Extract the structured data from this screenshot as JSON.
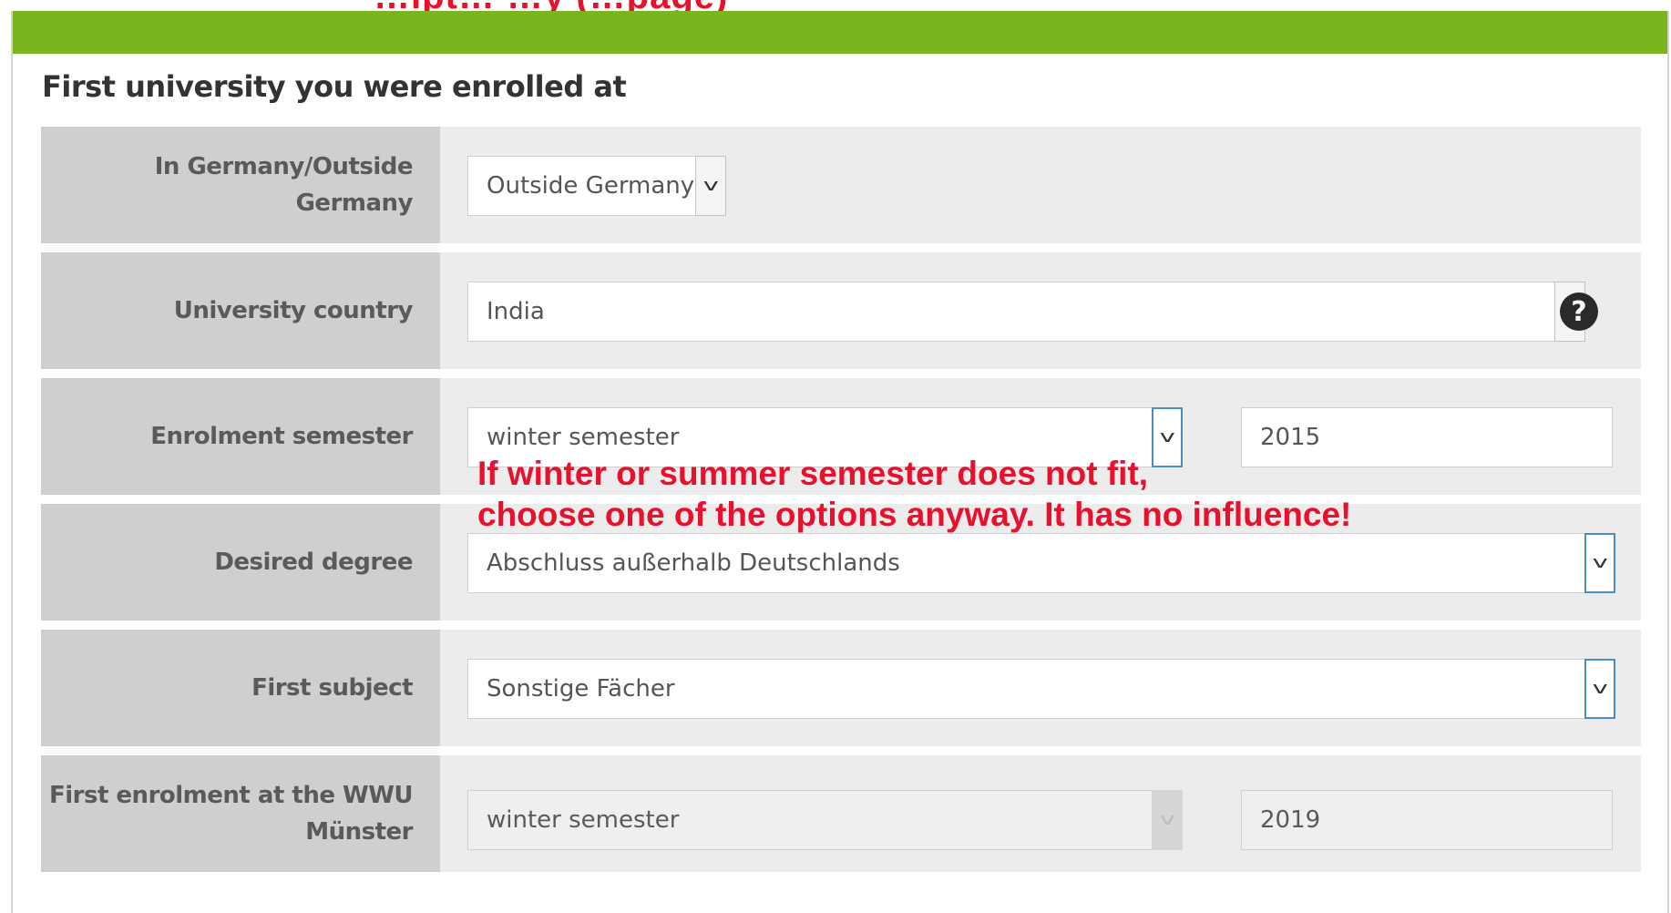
{
  "top_banner_text": "…ipt… …y (…page)",
  "section": {
    "title": "First university you were enrolled at"
  },
  "rows": [
    {
      "label": "In Germany/Outside Germany",
      "select_value": "Outside Germany"
    },
    {
      "label": "University country",
      "select_value": "India",
      "help_icon": "question-circle-icon"
    },
    {
      "label": "Enrolment semester",
      "select_value": "winter semester",
      "year_value": "2015"
    },
    {
      "label": "Desired degree",
      "select_value": "Abschluss außerhalb Deutschlands"
    },
    {
      "label": "First subject",
      "select_value": "Sonstige Fächer"
    },
    {
      "label_line1": "First enrolment at the WWU",
      "label_line2": "Münster",
      "select_value": "winter semester",
      "year_value": "2019",
      "disabled": true
    }
  ],
  "annotation": {
    "line1": "If winter or summer semester does not fit,",
    "line2": "choose one of the options anyway. It has no influence!"
  },
  "colors": {
    "header_bar": "#7ab51d",
    "annotation": "#e8112d",
    "label_bg": "#cfcfcf",
    "row_bg": "#ececec",
    "focus_border": "#4a8ec8"
  },
  "icons": {
    "chevron": "chevron-down-icon",
    "help": "question-circle-icon"
  }
}
